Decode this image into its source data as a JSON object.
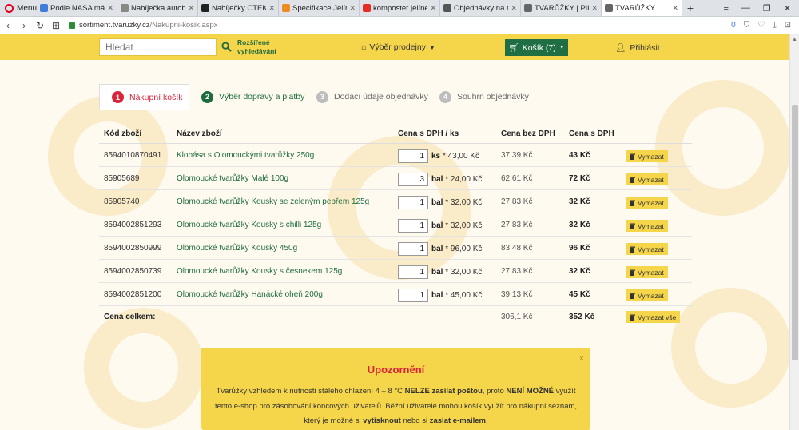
{
  "browser": {
    "menu_label": "Menu",
    "tabs": [
      {
        "title": "Podle NASA má na",
        "color": "#3b7dd8"
      },
      {
        "title": "Nabíječka autobat",
        "color": "#888888"
      },
      {
        "title": "Nabíječky CTEK - N",
        "color": "#222222"
      },
      {
        "title": "Specifikace Jelínek",
        "color": "#f08a24"
      },
      {
        "title": "komposter jelínek",
        "color": "#e52d27"
      },
      {
        "title": "Objednávky na tva",
        "color": "#555555"
      },
      {
        "title": "TVARŮŽKY | Plísňo",
        "color": "#666666"
      },
      {
        "title": "TVARŮŽKY |",
        "color": "#666666"
      }
    ],
    "url_domain": "sortiment.tvaruzky.cz",
    "url_path": "/Nakupni-kosik.aspx",
    "badge_count": "0"
  },
  "header": {
    "search_placeholder": "Hledat",
    "advanced_search_line1": "Rozšířené",
    "advanced_search_line2": "vyhledávání",
    "branch_label": "Výběr prodejny",
    "cart_label": "Košík (7)",
    "login_label": "Přihlásit"
  },
  "steps": [
    {
      "num": "1",
      "label": "Nákupní košík"
    },
    {
      "num": "2",
      "label": "Výběr dopravy a platby"
    },
    {
      "num": "3",
      "label": "Dodací údaje objednávky"
    },
    {
      "num": "4",
      "label": "Souhrn objednávky"
    }
  ],
  "table": {
    "headers": {
      "code": "Kód zboží",
      "name": "Název zboží",
      "price_vat_unit": "Cena s DPH  / ks",
      "price_no_vat": "Cena bez DPH",
      "price_vat": "Cena s DPH"
    },
    "rows": [
      {
        "code": "8594010870491",
        "name": "Klobása s Olomouckými tvarůžky 250g",
        "qty": "1",
        "unit": "ks",
        "unit_price": "* 43,00 Kč",
        "nett": "37,39 Kč",
        "gross": "43 Kč",
        "delete": "Vymazat"
      },
      {
        "code": "85905689",
        "name": "Olomoucké tvarůžky Malé 100g",
        "qty": "3",
        "unit": "bal",
        "unit_price": "* 24,00 Kč",
        "nett": "62,61 Kč",
        "gross": "72 Kč",
        "delete": "Vymazat"
      },
      {
        "code": "85905740",
        "name": "Olomoucké tvarůžky Kousky se zeleným pepřem 125g",
        "qty": "1",
        "unit": "bal",
        "unit_price": "* 32,00 Kč",
        "nett": "27,83 Kč",
        "gross": "32 Kč",
        "delete": "Vymazat"
      },
      {
        "code": "8594002851293",
        "name": "Olomoucké tvarůžky Kousky s chilli 125g",
        "qty": "1",
        "unit": "bal",
        "unit_price": "* 32,00 Kč",
        "nett": "27,83 Kč",
        "gross": "32 Kč",
        "delete": "Vymazat"
      },
      {
        "code": "8594002850999",
        "name": "Olomoucké tvarůžky Kousky 450g",
        "qty": "1",
        "unit": "bal",
        "unit_price": "* 96,00 Kč",
        "nett": "83,48 Kč",
        "gross": "96 Kč",
        "delete": "Vymazat"
      },
      {
        "code": "8594002850739",
        "name": "Olomoucké tvarůžky Kousky s česnekem 125g",
        "qty": "1",
        "unit": "bal",
        "unit_price": "* 32,00 Kč",
        "nett": "27,83 Kč",
        "gross": "32 Kč",
        "delete": "Vymazat"
      },
      {
        "code": "8594002851200",
        "name": "Olomoucké tvarůžky Hanácké oheň 200g",
        "qty": "1",
        "unit": "bal",
        "unit_price": "* 45,00 Kč",
        "nett": "39,13 Kč",
        "gross": "45 Kč",
        "delete": "Vymazat"
      }
    ],
    "total": {
      "label": "Cena celkem:",
      "nett": "306,1 Kč",
      "gross": "352 Kč",
      "delete_all": "Vymazat vše"
    }
  },
  "warning": {
    "title": "Upozornění",
    "close": "×",
    "text_1": "Tvarůžky vzhledem k nutnosti stálého chlazení 4 – 8 °C ",
    "text_bold_1": "NELZE zasílat poštou",
    "text_2": ", proto ",
    "text_bold_2": "NENÍ MOŽNÉ",
    "text_3": " využít tento e-shop pro zásobování koncových uživatelů. Běžní uživatelé mohou košík využít pro nákupní seznam, který je možné si ",
    "text_bold_3": "vytisknout",
    "text_4": " nebo si ",
    "text_bold_4": "zaslat e-mailem",
    "text_5": "."
  },
  "colors": {
    "brand_yellow": "#f5d54a",
    "brand_green": "#1f6e44",
    "accent_red": "#d9243a"
  }
}
